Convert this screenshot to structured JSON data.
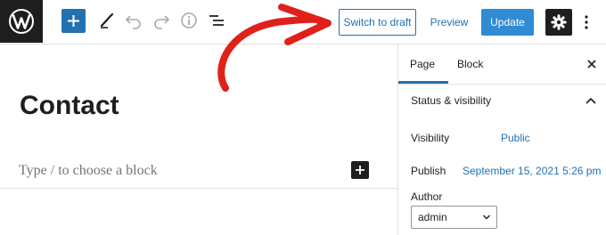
{
  "toolbar": {
    "switch_to_draft_label": "Switch to draft",
    "preview_label": "Preview",
    "update_label": "Update"
  },
  "icons": {
    "logo": "wordpress-logo-icon",
    "add": "plus-icon",
    "tools": "pencil-icon",
    "undo": "undo-icon",
    "redo": "redo-icon",
    "details": "info-icon",
    "outline": "list-view-icon",
    "settings": "gear-icon",
    "more": "vertical-ellipsis-icon",
    "close": "close-icon",
    "collapse": "chevron-up-icon",
    "select": "chevron-down-icon",
    "annotation": "red-curved-arrow"
  },
  "editor": {
    "title": "Contact",
    "block_placeholder": "Type / to choose a block"
  },
  "sidebar": {
    "tabs": [
      {
        "label": "Page",
        "active": true
      },
      {
        "label": "Block",
        "active": false
      }
    ],
    "panel": {
      "title": "Status & visibility",
      "rows": [
        {
          "label": "Visibility",
          "value": "Public"
        },
        {
          "label": "Publish",
          "value": "September 15, 2021 5:26 pm"
        }
      ],
      "author_label": "Author",
      "author_value": "admin"
    }
  },
  "colors": {
    "accent": "#2271b1",
    "update_button": "#2f8bd4",
    "dark": "#1e1e1e",
    "annotation": "#e0201b"
  }
}
